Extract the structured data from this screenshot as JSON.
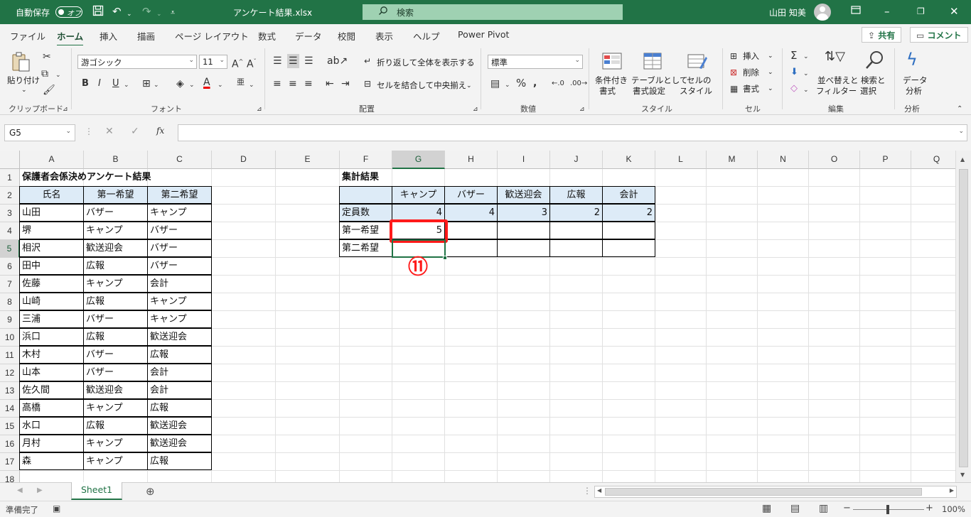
{
  "title_bar": {
    "autosave_label": "自動保存",
    "autosave_state": "オフ",
    "file_name": "アンケート結果.xlsx",
    "search_placeholder": "検索",
    "user_name": "山田 知美"
  },
  "menu": {
    "tabs": [
      "ファイル",
      "ホーム",
      "挿入",
      "描画",
      "ページ レイアウト",
      "数式",
      "データ",
      "校閲",
      "表示",
      "ヘルプ",
      "Power Pivot"
    ],
    "share_label": "共有",
    "comment_label": "コメント"
  },
  "ribbon": {
    "clipboard": {
      "paste": "貼り付け",
      "label": "クリップボード"
    },
    "font": {
      "name": "游ゴシック",
      "size": "11",
      "label": "フォント"
    },
    "alignment": {
      "wrap": "折り返して全体を表示する",
      "merge": "セルを結合して中央揃え",
      "label": "配置"
    },
    "number": {
      "format": "標準",
      "label": "数値"
    },
    "styles": {
      "cond1": "条件付き",
      "cond2": "書式",
      "table1": "テーブルとして",
      "table2": "書式設定",
      "cell1": "セルの",
      "cell2": "スタイル",
      "label": "スタイル"
    },
    "cells": {
      "insert": "挿入",
      "delete": "削除",
      "format": "書式",
      "label": "セル"
    },
    "editing": {
      "sort1": "並べ替えと",
      "sort2": "フィルター",
      "find1": "検索と",
      "find2": "選択",
      "label": "編集"
    },
    "analysis": {
      "data1": "データ",
      "data2": "分析",
      "label": "分析"
    }
  },
  "formula_bar": {
    "name_box": "G5",
    "formula": ""
  },
  "columns": [
    "A",
    "B",
    "C",
    "D",
    "E",
    "F",
    "G",
    "H",
    "I",
    "J",
    "K",
    "L",
    "M",
    "N",
    "O",
    "P",
    "Q"
  ],
  "rows": [
    "1",
    "2",
    "3",
    "4",
    "5",
    "6",
    "7",
    "8",
    "9",
    "10",
    "11",
    "12",
    "13",
    "14",
    "15",
    "16",
    "17",
    "18"
  ],
  "survey": {
    "title": "保護者会係決めアンケート結果",
    "headers": [
      "氏名",
      "第一希望",
      "第二希望"
    ],
    "rows": [
      [
        "山田",
        "バザー",
        "キャンプ"
      ],
      [
        "堺",
        "キャンプ",
        "バザー"
      ],
      [
        "相沢",
        "歓送迎会",
        "バザー"
      ],
      [
        "田中",
        "広報",
        "バザー"
      ],
      [
        "佐藤",
        "キャンプ",
        "会計"
      ],
      [
        "山崎",
        "広報",
        "キャンプ"
      ],
      [
        "三浦",
        "バザー",
        "キャンプ"
      ],
      [
        "浜口",
        "広報",
        "歓送迎会"
      ],
      [
        "木村",
        "バザー",
        "広報"
      ],
      [
        "山本",
        "バザー",
        "会計"
      ],
      [
        "佐久間",
        "歓送迎会",
        "会計"
      ],
      [
        "高橋",
        "キャンプ",
        "広報"
      ],
      [
        "水口",
        "広報",
        "歓送迎会"
      ],
      [
        "月村",
        "キャンプ",
        "歓送迎会"
      ],
      [
        "森",
        "キャンプ",
        "広報"
      ]
    ]
  },
  "summary": {
    "title": "集計結果",
    "headers": [
      "キャンプ",
      "バザー",
      "歓送迎会",
      "広報",
      "会計"
    ],
    "rows": [
      {
        "label": "定員数",
        "values": [
          "4",
          "4",
          "3",
          "2",
          "2"
        ]
      },
      {
        "label": "第一希望",
        "values": [
          "5",
          "",
          "",
          "",
          ""
        ]
      },
      {
        "label": "第二希望",
        "values": [
          "",
          "",
          "",
          "",
          ""
        ]
      }
    ]
  },
  "annotation": "⑪",
  "sheet_tab": "Sheet1",
  "status_bar": {
    "ready": "準備完了",
    "zoom": "100%"
  }
}
